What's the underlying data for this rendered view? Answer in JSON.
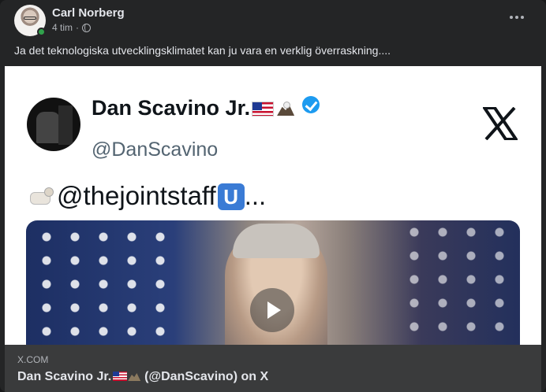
{
  "post": {
    "author": "Carl Norberg",
    "time": "4 tim",
    "separator": "·",
    "audience_icon": "globe-icon",
    "online": true,
    "text": "Ja det teknologiska utvecklingsklimatet kan ju vara en verklig överraskning...."
  },
  "embed": {
    "tweet_name": "Dan Scavino Jr.",
    "tweet_handle": "@DanScavino",
    "tweet_text": "@thejointstaff",
    "tweet_badge": "U",
    "tweet_ellipsis": "...",
    "brand_icon": "x-logo-icon"
  },
  "link": {
    "domain": "X.COM",
    "title_prefix": "Dan Scavino Jr.",
    "title_suffix": "(@DanScavino) on X"
  },
  "colors": {
    "card_bg": "#242526",
    "footer_bg": "#3a3b3c",
    "verified": "#1d9bf0",
    "online": "#31a24c"
  }
}
